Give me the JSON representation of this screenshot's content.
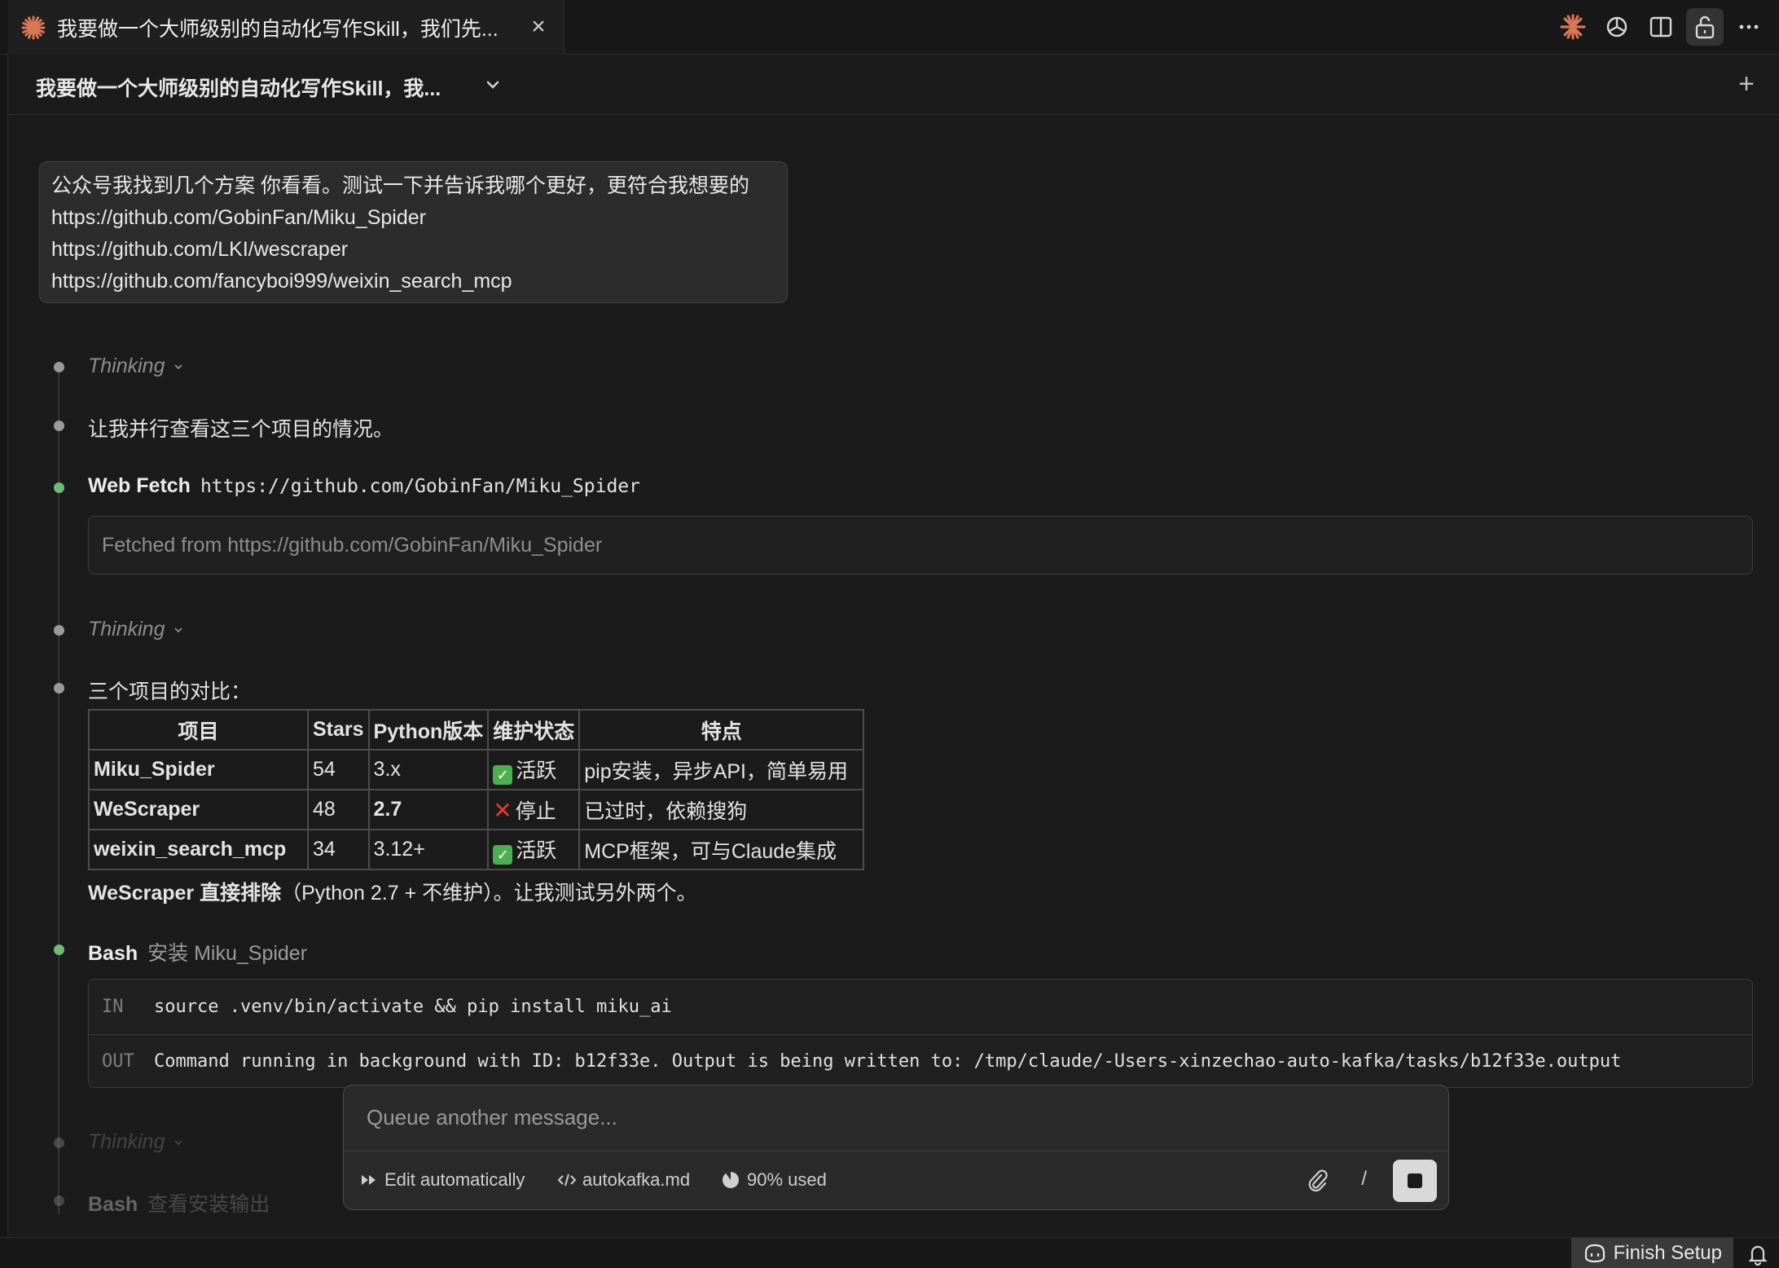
{
  "tab": {
    "title": "我要做一个大师级别的自动化写作Skill，我们先..."
  },
  "header": {
    "title": "我要做一个大师级别的自动化写作Skill，我..."
  },
  "user_message": {
    "lines": [
      "公众号我找到几个方案 你看看。测试一下并告诉我哪个更好，更符合我想要的",
      "https://github.com/GobinFan/Miku_Spider",
      "https://github.com/LKI/wescraper",
      "https://github.com/fancyboi999/weixin_search_mcp"
    ]
  },
  "steps": {
    "thinking_label": "Thinking",
    "text1": "让我并行查看这三个项目的情况。",
    "webfetch": {
      "name": "Web Fetch",
      "url": "https://github.com/GobinFan/Miku_Spider",
      "result": "Fetched from https://github.com/GobinFan/Miku_Spider"
    },
    "compare_intro": "三个项目的对比：",
    "table": {
      "headers": [
        "项目",
        "Stars",
        "Python版本",
        "维护状态",
        "特点"
      ],
      "rows": [
        {
          "name": "Miku_Spider",
          "stars": "54",
          "python": "3.x",
          "status": "活跃",
          "feature": "pip安装，异步API，简单易用"
        },
        {
          "name": "WeScraper",
          "stars": "48",
          "python": "2.7",
          "status": "停止",
          "feature": "已过时，依赖搜狗"
        },
        {
          "name": "weixin_search_mcp",
          "stars": "34",
          "python": "3.12+",
          "status": "活跃",
          "feature": "MCP框架，可与Claude集成"
        }
      ]
    },
    "conclusion_bold": "WeScraper 直接排除",
    "conclusion_rest": "（Python 2.7 + 不维护）。让我测试另外两个。",
    "bash1": {
      "name": "Bash",
      "desc": "安装 Miku_Spider",
      "in_label": "IN",
      "in": "source .venv/bin/activate && pip install miku_ai",
      "out_label": "OUT",
      "out": "Command running in background with ID: b12f33e. Output is being written to: /tmp/claude/-Users-xinzechao-auto-kafka/tasks/b12f33e.output"
    },
    "bash2": {
      "name": "Bash",
      "desc": "查看安装输出"
    }
  },
  "composer": {
    "placeholder": "Queue another message...",
    "mode": "Edit automatically",
    "file": "autokafka.md",
    "usage": "90% used",
    "slash": "/"
  },
  "statusbar": {
    "finish": "Finish Setup"
  },
  "colors": {
    "background": "#1b1b1b",
    "accent": "#d97757",
    "green_dot": "#6dbb75"
  }
}
